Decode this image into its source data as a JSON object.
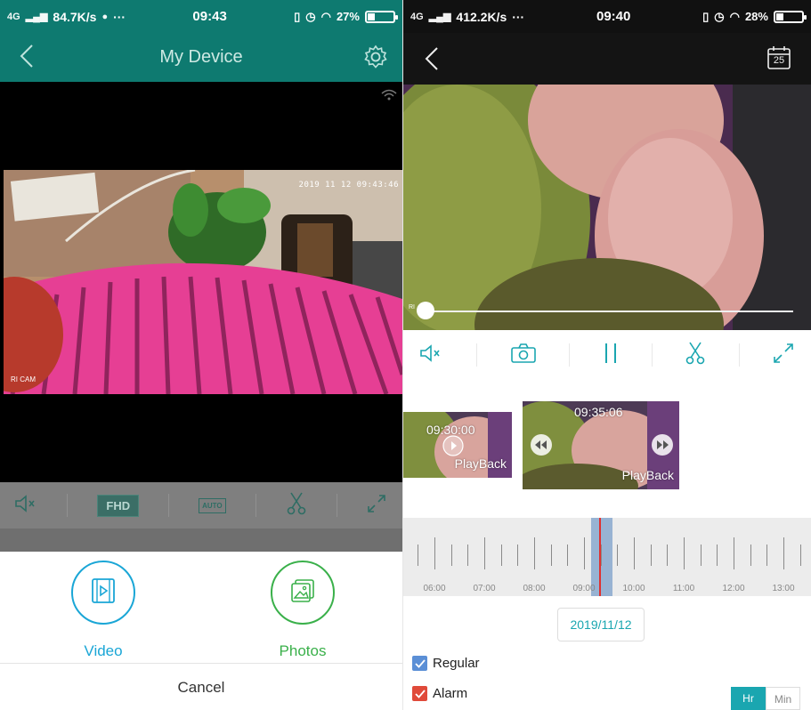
{
  "left": {
    "status": {
      "network": "4G",
      "rate": "84.7K/s",
      "more": "···",
      "time": "09:43",
      "battery": "27%",
      "battery_level": 27
    },
    "header": {
      "title": "My Device"
    },
    "camera": {
      "timestamp": "2019 11 12 09:43:46",
      "watermark": "RI CAM"
    },
    "toolbar": {
      "quality_label": "FHD",
      "auto_label": "AUTO"
    },
    "sheet": {
      "video_label": "Video",
      "photos_label": "Photos",
      "cancel_label": "Cancel"
    },
    "colors": {
      "primary": "#0e7a70",
      "video_accent": "#1aa6d6",
      "photos_accent": "#3ab04a"
    }
  },
  "right": {
    "status": {
      "network": "4G",
      "rate": "412.2K/s",
      "more": "···",
      "time": "09:40",
      "battery": "28%",
      "battery_level": 28
    },
    "header": {
      "calendar_day": "25"
    },
    "video": {
      "watermark": "RI"
    },
    "thumbnails": [
      {
        "time": "09:30:00",
        "label": "PlayBack"
      },
      {
        "time": "09:35:06",
        "label": "PlayBack"
      }
    ],
    "timeline": {
      "hours": [
        "06:00",
        "07:00",
        "08:00",
        "09:00",
        "10:00",
        "11:00",
        "12:00",
        "13:00"
      ]
    },
    "date": "2019/11/12",
    "legend": [
      {
        "label": "Regular",
        "color": "#5b8fd6"
      },
      {
        "label": "Alarm",
        "color": "#e04a3a"
      }
    ],
    "zoom": {
      "hr_label": "Hr",
      "min_label": "Min",
      "selected": "Hr"
    }
  }
}
